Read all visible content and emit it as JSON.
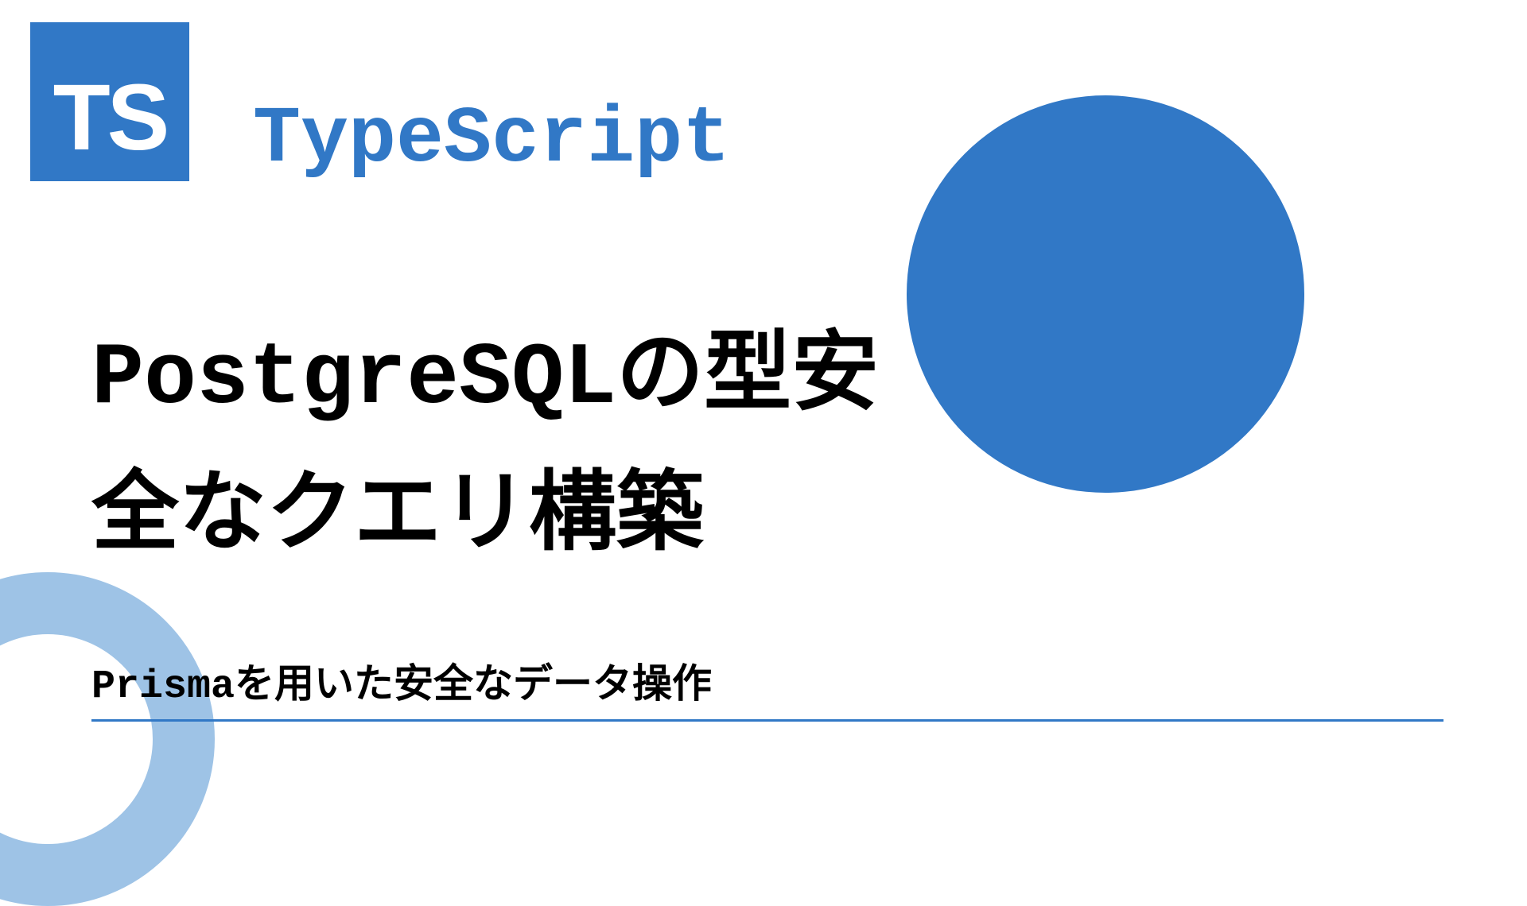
{
  "logo": {
    "text": "TS"
  },
  "brand": "TypeScript",
  "title": "PostgreSQLの型安全なクエリ構築",
  "subtitle": "Prismaを用いた安全なデータ操作",
  "colors": {
    "primary": "#3178c6",
    "ring": "#9ec3e6"
  }
}
